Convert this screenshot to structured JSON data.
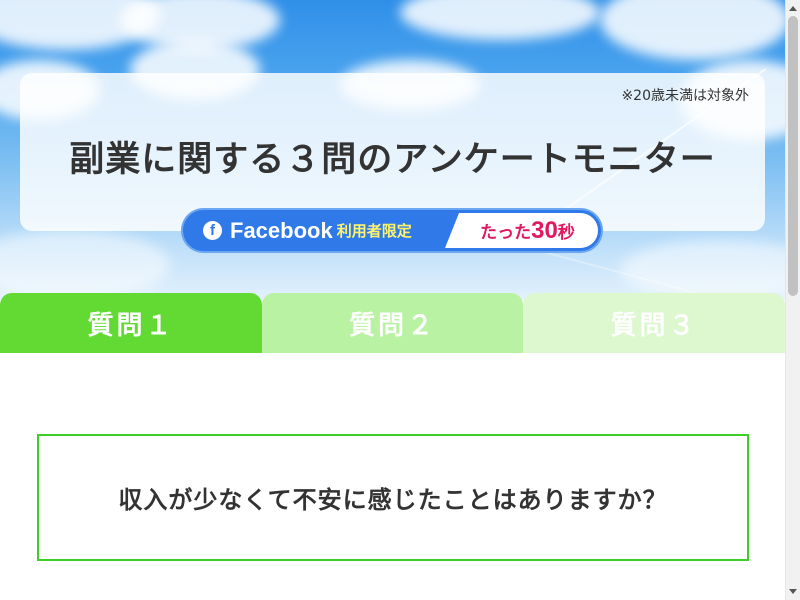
{
  "hero": {
    "age_note": "※20歳未満は対象外",
    "title": "副業に関する３問のアンケートモニター",
    "badge": {
      "icon": "facebook-icon",
      "icon_glyph": "f",
      "brand": "Facebook",
      "limited": "利用者限定",
      "time_prefix": "たった",
      "time_number": "30",
      "time_unit": "秒"
    }
  },
  "tabs": [
    {
      "label": "質問１",
      "state": "active"
    },
    {
      "label": "質問２",
      "state": "inactive"
    },
    {
      "label": "質問３",
      "state": "inactive"
    }
  ],
  "question": {
    "text": "収入が少なくて不安に感じたことはありますか？"
  },
  "colors": {
    "tab_active": "#63d934",
    "tab_second": "#baf2a4",
    "tab_third": "#ddf7cf",
    "badge_blue": "#2f7ae8",
    "accent_pink": "#e0185f",
    "box_border": "#3ccf28"
  }
}
